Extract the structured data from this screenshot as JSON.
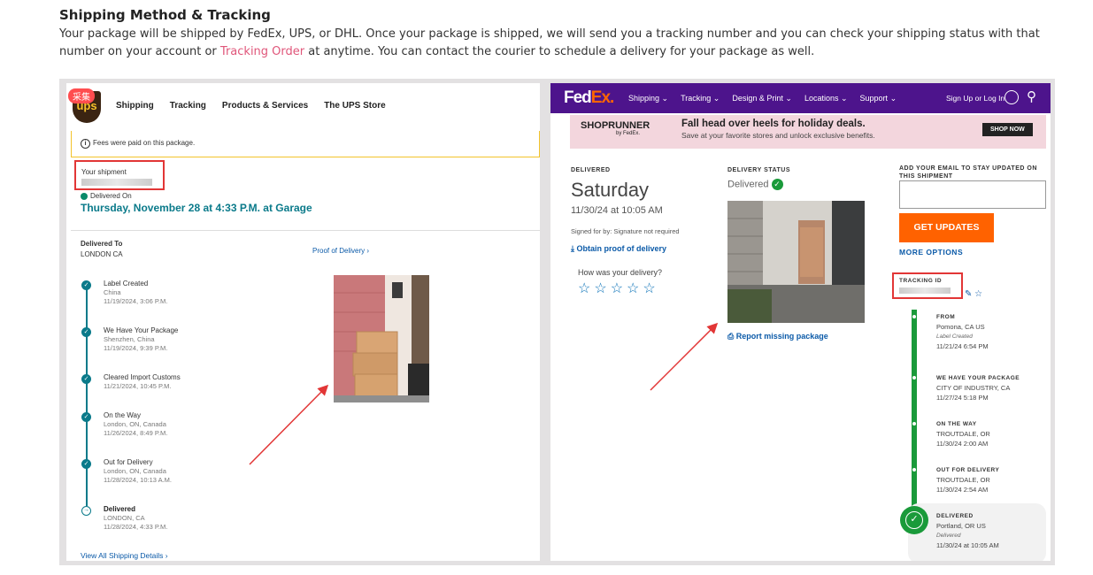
{
  "intro": {
    "title": "Shipping Method & Tracking",
    "text_1": "Your package will be shipped by FedEx, UPS, or DHL. Once your package is shipped, we will send you a tracking number and you can check your shipping status with that number on your account or ",
    "link": "Tracking Order",
    "text_2": " at anytime. You can contact the courier to schedule a delivery for your package as well."
  },
  "ups": {
    "badge": "采集",
    "logo": "ups",
    "nav": [
      "Shipping",
      "Tracking",
      "Products & Services",
      "The UPS Store"
    ],
    "fees_note": "Fees were paid on this package.",
    "your_shipment": "Your shipment",
    "delivered_on": "Delivered On",
    "delivered_date": "Thursday, November 28 at 4:33 P.M. at Garage",
    "delivered_to_label": "Delivered To",
    "delivered_to": "LONDON CA",
    "proof_of_delivery": "Proof of Delivery",
    "timeline": [
      {
        "title": "Label Created",
        "place": "China",
        "time": "11/19/2024, 3:06 P.M."
      },
      {
        "title": "We Have Your Package",
        "place": "Shenzhen, China",
        "time": "11/19/2024, 9:39 P.M."
      },
      {
        "title": "Cleared Import Customs",
        "place": "",
        "time": "11/21/2024, 10:45 P.M."
      },
      {
        "title": "On the Way",
        "place": "London, ON, Canada",
        "time": "11/26/2024, 8:49 P.M."
      },
      {
        "title": "Out for Delivery",
        "place": "London, ON, Canada",
        "time": "11/28/2024, 10:13 A.M."
      },
      {
        "title": "Delivered",
        "place": "LONDON, CA",
        "time": "11/28/2024, 4:33 P.M."
      }
    ],
    "view_all": "View All Shipping Details"
  },
  "fedex": {
    "logo_fed": "Fed",
    "logo_ex": "Ex.",
    "nav": [
      "Shipping",
      "Tracking",
      "Design & Print",
      "Locations",
      "Support"
    ],
    "sign_in": "Sign Up or Log In",
    "banner": {
      "brand": "SHOPRUNNER",
      "brand_sub": "by FedEx.",
      "headline": "Fall head over heels for holiday deals.",
      "subline": "Save at your favorite stores and unlock exclusive benefits.",
      "cta": "SHOP NOW"
    },
    "delivered_label": "DELIVERED",
    "delivered_day": "Saturday",
    "delivered_time": "11/30/24 at 10:05 AM",
    "signed_for": "Signed for by: Signature not required",
    "obtain_proof": "Obtain proof of delivery",
    "how_was": "How was your delivery?",
    "stars": "☆☆☆☆☆",
    "status_label": "DELIVERY STATUS",
    "status": "Delivered",
    "report_missing": "Report missing package",
    "email_label": "ADD YOUR EMAIL TO STAY UPDATED ON THIS SHIPMENT",
    "get_updates": "GET UPDATES",
    "more_options": "MORE OPTIONS",
    "tracking_id_label": "TRACKING ID",
    "steps": [
      {
        "title": "FROM",
        "place": "Pomona, CA US",
        "note": "Label Created",
        "time": "11/21/24 6:54 PM"
      },
      {
        "title": "WE HAVE YOUR PACKAGE",
        "place": "CITY OF INDUSTRY, CA",
        "note": "",
        "time": "11/27/24 5:18 PM"
      },
      {
        "title": "ON THE WAY",
        "place": "TROUTDALE, OR",
        "note": "",
        "time": "11/30/24 2:00 AM"
      },
      {
        "title": "OUT FOR DELIVERY",
        "place": "TROUTDALE, OR",
        "note": "",
        "time": "11/30/24 2:54 AM"
      },
      {
        "title": "DELIVERED",
        "place": "Portland, OR US",
        "note": "Delivered",
        "time": "11/30/24 at 10:05 AM"
      }
    ]
  },
  "colors": {
    "link_pink": "#e0567a",
    "fedex_purple": "#4d148c",
    "fedex_orange": "#ff6200",
    "ups_teal": "#0a7a8a",
    "highlight_red": "#e23636"
  }
}
